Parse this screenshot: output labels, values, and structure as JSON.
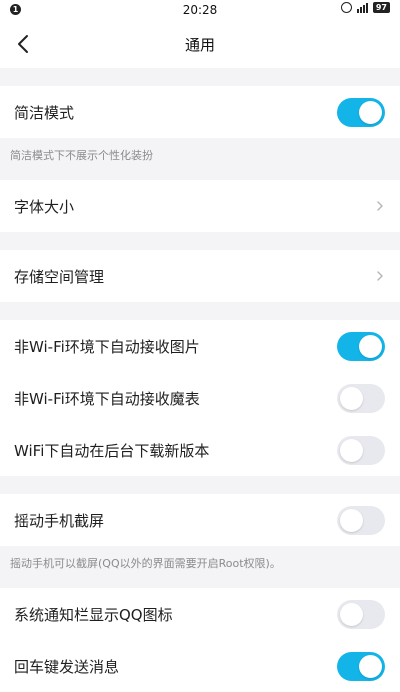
{
  "status_bar": {
    "notification_count": "1",
    "time": "20:28",
    "battery": "97"
  },
  "navbar": {
    "title": "通用"
  },
  "settings": {
    "simple_mode": {
      "label": "简洁模式",
      "enabled": true
    },
    "simple_mode_hint": "简洁模式下不展示个性化装扮",
    "font_size": {
      "label": "字体大小"
    },
    "storage": {
      "label": "存储空间管理"
    },
    "auto_receive_images": {
      "label": "非Wi-Fi环境下自动接收图片",
      "enabled": true
    },
    "auto_receive_magic": {
      "label": "非Wi-Fi环境下自动接收魔表",
      "enabled": false
    },
    "auto_download_update": {
      "label": "WiFi下自动在后台下载新版本",
      "enabled": false
    },
    "shake_screenshot": {
      "label": "摇动手机截屏",
      "enabled": false
    },
    "shake_hint": "摇动手机可以截屏(QQ以外的界面需要开启Root权限)。",
    "notification_icon": {
      "label": "系统通知栏显示QQ图标",
      "enabled": false
    },
    "enter_send": {
      "label": "回车键发送消息",
      "enabled": true
    }
  },
  "colors": {
    "toggle_on": "#13b5e8",
    "toggle_off": "#e8e9ee",
    "background": "#f4f4f6"
  }
}
